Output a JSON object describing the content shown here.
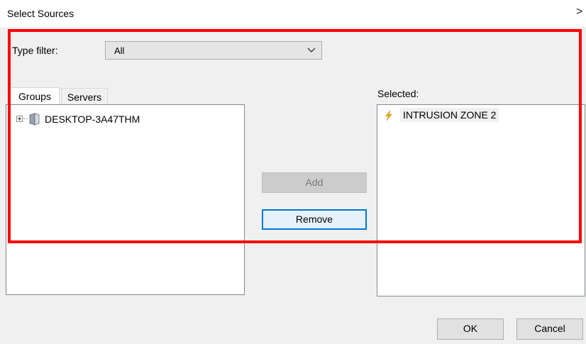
{
  "dialog": {
    "title": "Select Sources",
    "close_glyph": "×"
  },
  "filter": {
    "label": "Type filter:",
    "value": "All"
  },
  "tabs": [
    {
      "label": "Groups"
    },
    {
      "label": "Servers"
    }
  ],
  "tree": {
    "items": [
      {
        "label": "DESKTOP-3A47THM"
      }
    ]
  },
  "selected": {
    "label": "Selected:",
    "items": [
      {
        "label": "INTRUSION ZONE 2"
      }
    ]
  },
  "buttons": {
    "add": "Add",
    "remove": "Remove",
    "ok": "OK",
    "cancel": "Cancel"
  },
  "colors": {
    "highlight": "#ff0000",
    "focus": "#0078d7"
  }
}
